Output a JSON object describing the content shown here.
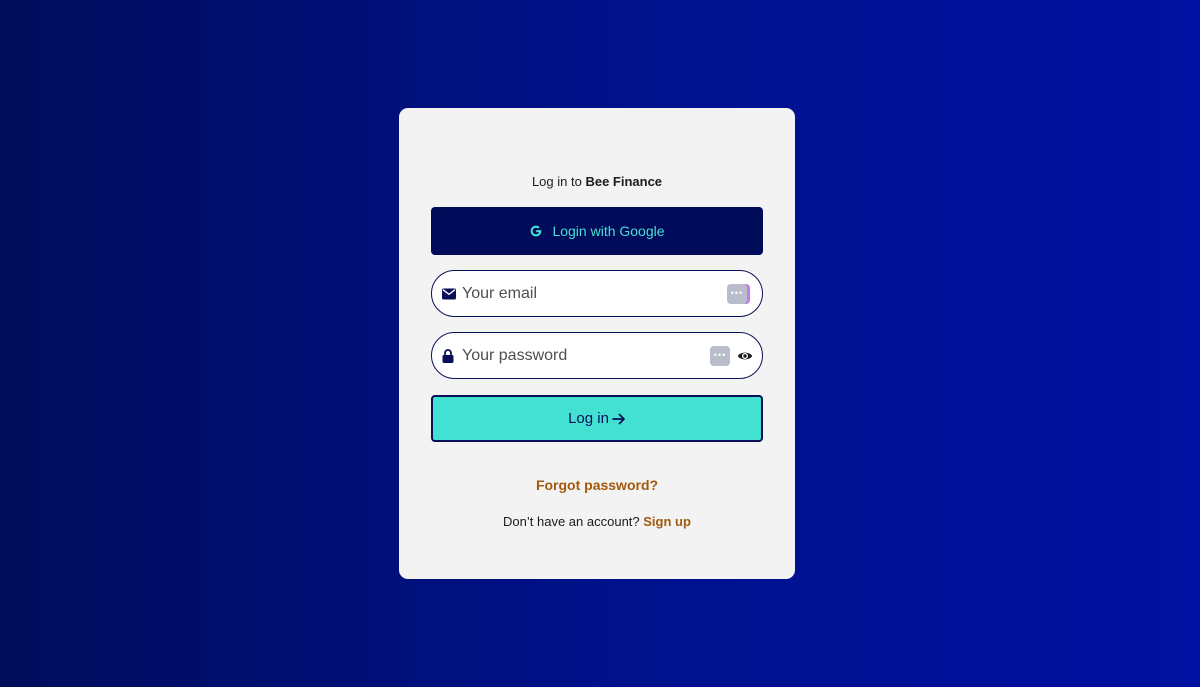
{
  "login_card": {
    "heading_prefix": "Log in to ",
    "heading_brand": "Bee Finance",
    "google_button_label": "Login with Google",
    "email_placeholder": "Your email",
    "password_placeholder": "Your password",
    "submit_label": "Log in",
    "forgot_password_label": "Forgot password?",
    "signup_prompt": "Don’t have an account? ",
    "signup_link_label": "Sign up"
  },
  "icons": {
    "google": "google-g-icon",
    "email": "envelope-icon",
    "password": "lock-icon",
    "toggle_visibility": "eye-icon",
    "submit": "arrow-right-icon",
    "password_manager": "password-manager-icon"
  },
  "colors": {
    "background_start": "#000d5c",
    "background_end": "#0010a0",
    "card": "#f3f3f3",
    "google_button": "#000b5a",
    "accent_teal": "#43e1d2",
    "link_brown": "#a3590c",
    "navy": "#0a1058"
  }
}
